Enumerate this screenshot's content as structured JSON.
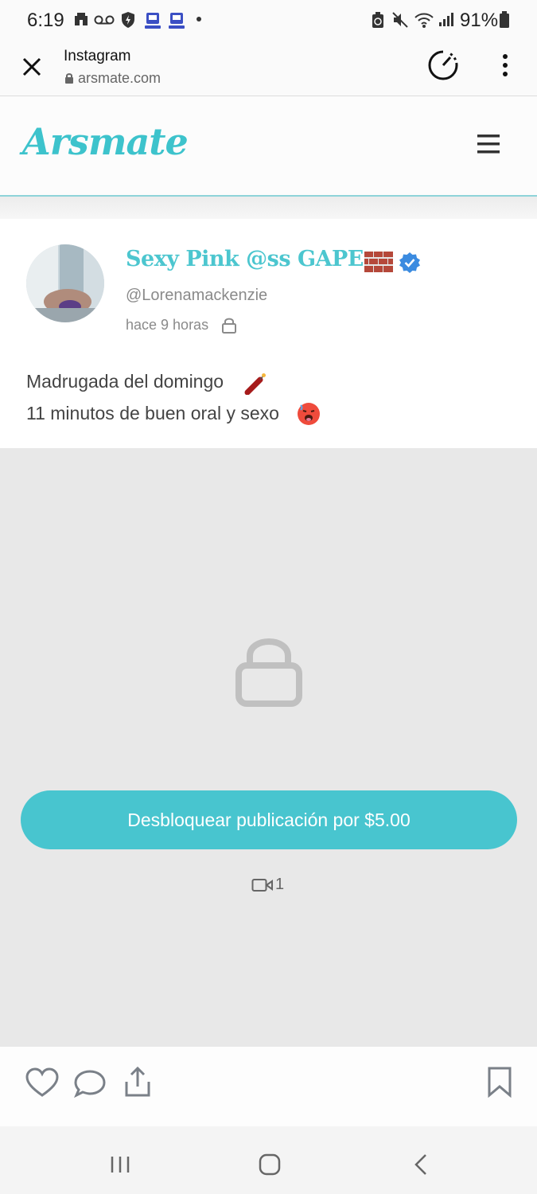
{
  "status_bar": {
    "time": "6:19",
    "battery": "91%"
  },
  "browser": {
    "title": "Instagram",
    "url": "arsmate.com"
  },
  "site": {
    "logo": "Arsmate",
    "accent_color": "#48c5cf"
  },
  "post": {
    "display_name": "Sexy Pink @ss GAPE",
    "username": "@Lorenamackenzie",
    "time": "hace 9 horas",
    "caption_line1": "Madrugada del domingo",
    "caption_line2": "11 minutos de buen oral y sexo",
    "unlock_label": "Desbloquear publicación por $5.00",
    "video_count": "1"
  },
  "icons": [
    "close-icon",
    "lock-icon",
    "menu-icon",
    "verified-icon",
    "heart-icon",
    "comment-icon",
    "share-icon",
    "bookmark-icon",
    "video-icon"
  ]
}
